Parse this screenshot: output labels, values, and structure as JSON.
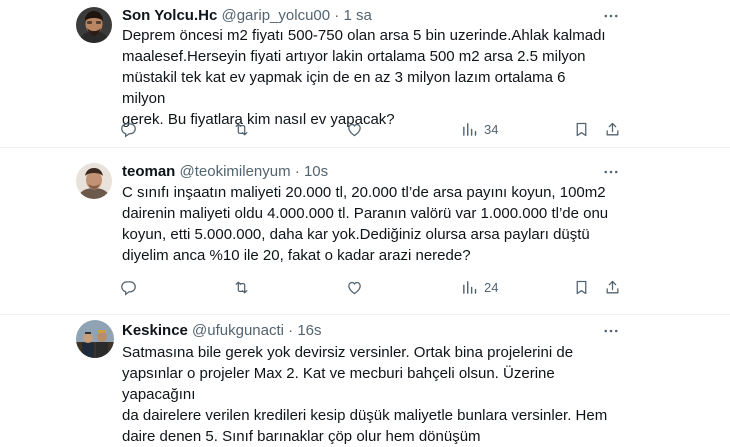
{
  "tweets": [
    {
      "name": "Son Yolcu.Hc",
      "handle": "@garip_yolcu00",
      "separator": "·",
      "time": "1 sa",
      "text": "Deprem öncesi m2 fiyatı 500-750 olan arsa 5 bin uzerinde.Ahlak kalmadı\nmaalesef.Herseyin fiyati artıyor lakin ortalama 500 m2 arsa 2.5 milyon\nmüstakil tek kat ev yapmak için de en az 3 milyon lazım ortalama 6 milyon\ngerek. Bu fiyatlara kim nasıl ev yapacak?",
      "views": "34",
      "icons": [
        "reply-icon",
        "retweet-icon",
        "like-icon",
        "views-icon",
        "bookmark-icon",
        "share-icon"
      ]
    },
    {
      "name": "teoman",
      "handle": "@teokimilenyum",
      "separator": "·",
      "time": "10s",
      "text": "C sınıfı inşaatın maliyeti 20.000 tl, 20.000 tl’de arsa payını koyun, 100m2\ndairenin maliyeti oldu 4.000.000 tl. Paranın valörü var 1.000.000 tl’de onu\nkoyun, etti 5.000.000, daha kar yok.Dediğiniz olursa arsa payları düştü\ndiyelim anca %10 ile 20, fakat o kadar arazi nerede?",
      "views": "24"
    },
    {
      "name": "Keskince",
      "handle": "@ufukgunacti",
      "separator": "·",
      "time": "16s",
      "text": "Satmasına bile gerek yok devirsiz versinler. Ortak bina projelerini de\nyapsınlar o projeler Max 2. Kat ve mecburi bahçeli olsun. Üzerine yapacağını\nda dairelere verilen kredileri kesip düşük maliyetle bunlara versinler. Hem\ndaire denen 5. Sınıf barınaklar çöp olur hem dönüşüm"
    }
  ],
  "colors": {
    "text": "#0f1419",
    "secondary": "#536471",
    "divider": "#eff3f4"
  }
}
